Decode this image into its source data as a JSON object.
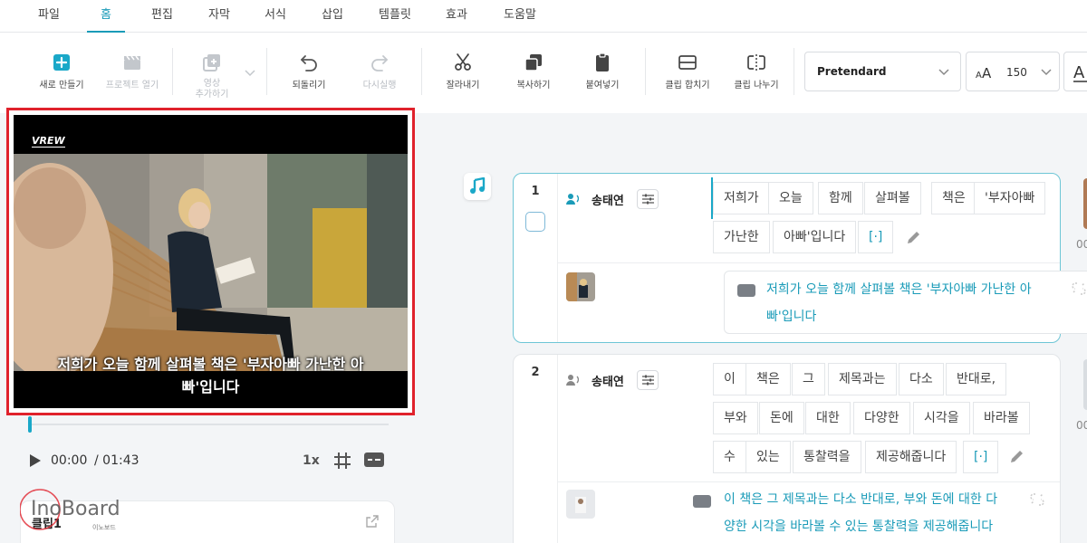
{
  "menu": {
    "items": [
      "파일",
      "홈",
      "편집",
      "자막",
      "서식",
      "삽입",
      "템플릿",
      "효과",
      "도움말"
    ],
    "active": "홈"
  },
  "toolbar": {
    "new": "새로 만들기",
    "project_open": "프로젝트 열기",
    "add_video_1": "영상",
    "add_video_2": "추가하기",
    "undo": "되돌리기",
    "redo": "다시실행",
    "cut": "잘라내기",
    "copy": "복사하기",
    "paste": "붙여넣기",
    "merge_clip": "클립 합치기",
    "split_clip": "클립 나누기",
    "font_family": "Pretendard",
    "font_size": "150"
  },
  "preview": {
    "logo": "VREW",
    "subtitle_line1": "저희가 오늘 함께 살펴볼 책은 '부자아빠 가난한 아",
    "subtitle_line2": "빠'입니다"
  },
  "player": {
    "current_time": "00:00",
    "total_time": "/ 01:43",
    "speed": "1x",
    "progress": 0.0
  },
  "clip_panel": {
    "label": "클립1"
  },
  "watermark": {
    "brand": "InoBoard",
    "sub": "이노보드"
  },
  "clips": [
    {
      "number": "1",
      "speaker": "송태연",
      "words": [
        "저희가",
        "오늘",
        "함께",
        "살펴볼",
        "책은",
        "'부자아빠",
        "가난한",
        "아빠'입니다",
        "[·]"
      ],
      "subtitle_line1": "저희가 오늘 함께 살펴볼 책은 '부자아빠 가난한 아",
      "subtitle_line2": "빠'입니다"
    },
    {
      "number": "2",
      "speaker": "송태연",
      "words": [
        "이",
        "책은",
        "그",
        "제목과는",
        "다소",
        "반대로,",
        "부와",
        "돈에",
        "대한",
        "다양한",
        "시각을",
        "바라볼",
        "수",
        "있는",
        "통찰력을",
        "제공해줍니다",
        "[·]"
      ],
      "subtitle_line1": "이 책은 그 제목과는 다소 반대로, 부와 돈에 대한 다",
      "subtitle_line2": "양한 시각을 바라볼 수 있는 통찰력을 제공해줍니다"
    }
  ],
  "edge": {
    "time": "00"
  },
  "colors": {
    "accent": "#1a9bb8",
    "highlight_border": "#e0222c",
    "panel_bg": "#f3f5f7"
  }
}
